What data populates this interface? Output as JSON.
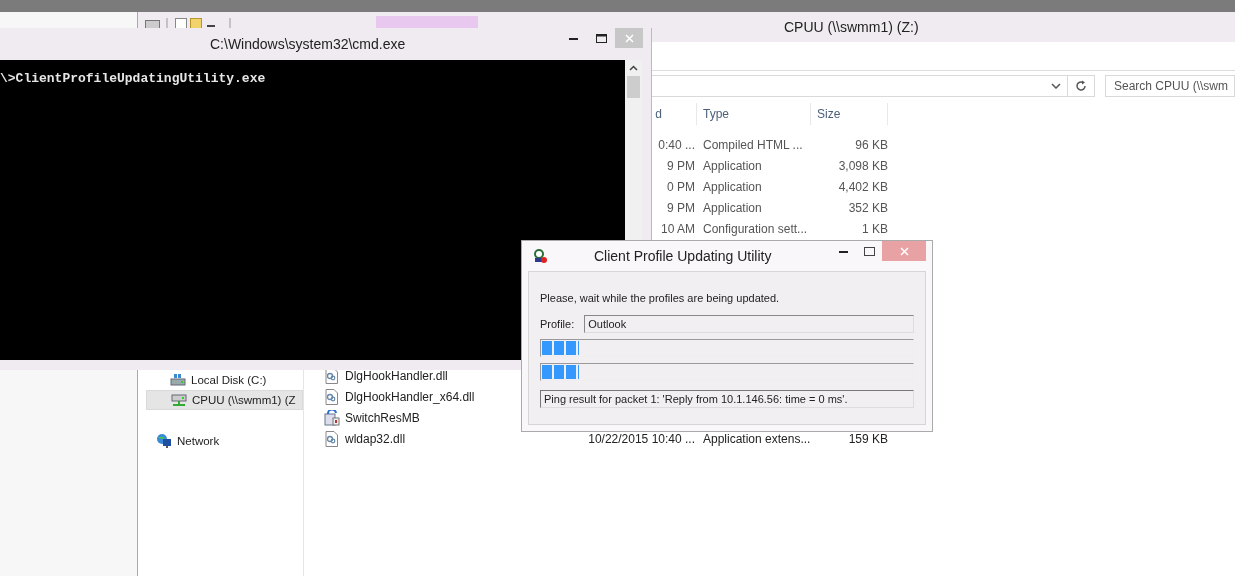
{
  "explorer": {
    "title": "CPUU (\\\\swmm1) (Z:)",
    "search": {
      "placeholder": "Search CPUU (\\\\swm"
    },
    "columns": [
      "d",
      "Type",
      "Size"
    ],
    "rows_upper": [
      {
        "date": "0:40 ...",
        "type": "Compiled HTML ...",
        "size": "96 KB"
      },
      {
        "date": "9 PM",
        "type": "Application",
        "size": "3,098 KB"
      },
      {
        "date": "0 PM",
        "type": "Application",
        "size": "4,402 KB"
      },
      {
        "date": "9 PM",
        "type": "Application",
        "size": "352 KB"
      },
      {
        "date": "10 AM",
        "type": "Configuration sett...",
        "size": "1 KB"
      }
    ],
    "nav": [
      {
        "label": "Local Disk (C:)",
        "kind": "disk",
        "selected": false
      },
      {
        "label": "CPUU (\\\\swmm1) (Z",
        "kind": "netdrive",
        "selected": true
      },
      {
        "label": "Network",
        "kind": "network",
        "selected": false
      }
    ],
    "rows_lower": [
      {
        "name": "DlgHookHandler.dll",
        "kind": "dll"
      },
      {
        "name": "DlgHookHandler_x64.dll",
        "kind": "dll"
      },
      {
        "name": "SwitchResMB",
        "kind": "app"
      },
      {
        "name": "wldap32.dll",
        "kind": "dll",
        "date": "10/22/2015 10:40 ...",
        "type": "Application extens...",
        "size": "159 KB"
      }
    ]
  },
  "console": {
    "title": "C:\\Windows\\system32\\cmd.exe",
    "lines": [
      "\\>ClientProfileUpdatingUtility.exe"
    ]
  },
  "dialog": {
    "title": "Client Profile Updating Utility",
    "message": "Please, wait while the profiles are being updated.",
    "profile_label": "Profile:",
    "profile_value": "Outlook",
    "progress": [
      {
        "level": 0.1
      },
      {
        "level": 0.1
      }
    ],
    "status": "Ping result for packet 1: 'Reply from 10.1.146.56: time = 0 ms'."
  }
}
